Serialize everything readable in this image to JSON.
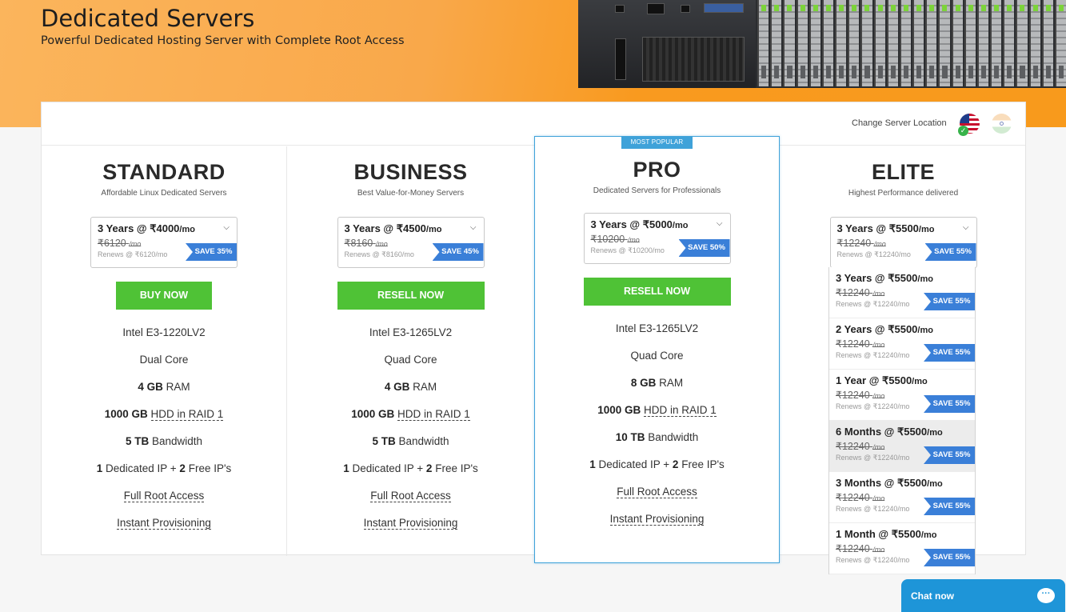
{
  "hero": {
    "title": "Dedicated Servers",
    "subtitle": "Powerful Dedicated Hosting Server with Complete Root Access"
  },
  "location": {
    "label": "Change Server Location",
    "flags": [
      "us-flag-icon",
      "india-flag-icon"
    ],
    "selected": "us"
  },
  "colors": {
    "hero_orange": "#f99a1f",
    "button_green": "#4fc236",
    "save_blue": "#3a7fd8",
    "popular_blue": "#3fa2d9",
    "chat_blue": "#1e95d8"
  },
  "plans": [
    {
      "name": "STANDARD",
      "tagline": "Affordable Linux Dedicated Servers",
      "term": "3 Years @ ₹4000",
      "per": "/mo",
      "old_price": "₹6120",
      "old_per": "/mo",
      "renews": "Renews @ ₹6120/mo",
      "save": "SAVE 35%",
      "button": "BUY NOW",
      "cpu": "Intel E3-1220LV2",
      "cores": "Dual Core",
      "ram_val": "4 GB",
      "ram_unit": "RAM",
      "disk_val": "1000 GB",
      "disk_type": "HDD in RAID 1",
      "bw_val": "5 TB",
      "bw_unit": "Bandwidth",
      "ip_a": "1",
      "ip_mid": "Dedicated IP +",
      "ip_b": "2",
      "ip_end": "Free IP's",
      "root": "Full Root Access",
      "provision": "Instant Provisioning"
    },
    {
      "name": "BUSINESS",
      "tagline": "Best Value-for-Money Servers",
      "term": "3 Years @ ₹4500",
      "per": "/mo",
      "old_price": "₹8160",
      "old_per": "/mo",
      "renews": "Renews @ ₹8160/mo",
      "save": "SAVE 45%",
      "button": "RESELL NOW",
      "cpu": "Intel E3-1265LV2",
      "cores": "Quad Core",
      "ram_val": "4 GB",
      "ram_unit": "RAM",
      "disk_val": "1000 GB",
      "disk_type": "HDD in RAID 1",
      "bw_val": "5 TB",
      "bw_unit": "Bandwidth",
      "ip_a": "1",
      "ip_mid": "Dedicated IP +",
      "ip_b": "2",
      "ip_end": "Free IP's",
      "root": "Full Root Access",
      "provision": "Instant Provisioning"
    },
    {
      "name": "PRO",
      "badge": "MOST POPULAR",
      "tagline": "Dedicated Servers for Professionals",
      "term": "3 Years @ ₹5000",
      "per": "/mo",
      "old_price": "₹10200",
      "old_per": "/mo",
      "renews": "Renews @ ₹10200/mo",
      "save": "SAVE 50%",
      "button": "RESELL NOW",
      "cpu": "Intel E3-1265LV2",
      "cores": "Quad Core",
      "ram_val": "8 GB",
      "ram_unit": "RAM",
      "disk_val": "1000 GB",
      "disk_type": "HDD in RAID 1",
      "bw_val": "10 TB",
      "bw_unit": "Bandwidth",
      "ip_a": "1",
      "ip_mid": "Dedicated IP +",
      "ip_b": "2",
      "ip_end": "Free IP's",
      "root": "Full Root Access",
      "provision": "Instant Provisioning"
    },
    {
      "name": "ELITE",
      "tagline": "Highest Performance delivered",
      "term": "3 Years @ ₹5500",
      "per": "/mo",
      "old_price": "₹12240",
      "old_per": "/mo",
      "renews": "Renews @ ₹12240/mo",
      "save": "SAVE 55%"
    }
  ],
  "elite_options": [
    {
      "term": "3 Years @ ₹5500",
      "per": "/mo",
      "old_price": "₹12240",
      "old_per": "/mo",
      "renews": "Renews @ ₹12240/mo",
      "save": "SAVE 55%"
    },
    {
      "term": "2 Years @ ₹5500",
      "per": "/mo",
      "old_price": "₹12240",
      "old_per": "/mo",
      "renews": "Renews @ ₹12240/mo",
      "save": "SAVE 55%"
    },
    {
      "term": "1 Year @ ₹5500",
      "per": "/mo",
      "old_price": "₹12240",
      "old_per": "/mo",
      "renews": "Renews @ ₹12240/mo",
      "save": "SAVE 55%"
    },
    {
      "term": "6 Months @ ₹5500",
      "per": "/mo",
      "old_price": "₹12240",
      "old_per": "/mo",
      "renews": "Renews @ ₹12240/mo",
      "save": "SAVE 55%",
      "highlighted": true
    },
    {
      "term": "3 Months @ ₹5500",
      "per": "/mo",
      "old_price": "₹12240",
      "old_per": "/mo",
      "renews": "Renews @ ₹12240/mo",
      "save": "SAVE 55%"
    },
    {
      "term": "1 Month @ ₹5500",
      "per": "/mo",
      "old_price": "₹12240",
      "old_per": "/mo",
      "renews": "Renews @ ₹12240/mo",
      "save": "SAVE 55%"
    }
  ],
  "chat": {
    "label": "Chat now",
    "icon": "chat-bubble-icon"
  }
}
